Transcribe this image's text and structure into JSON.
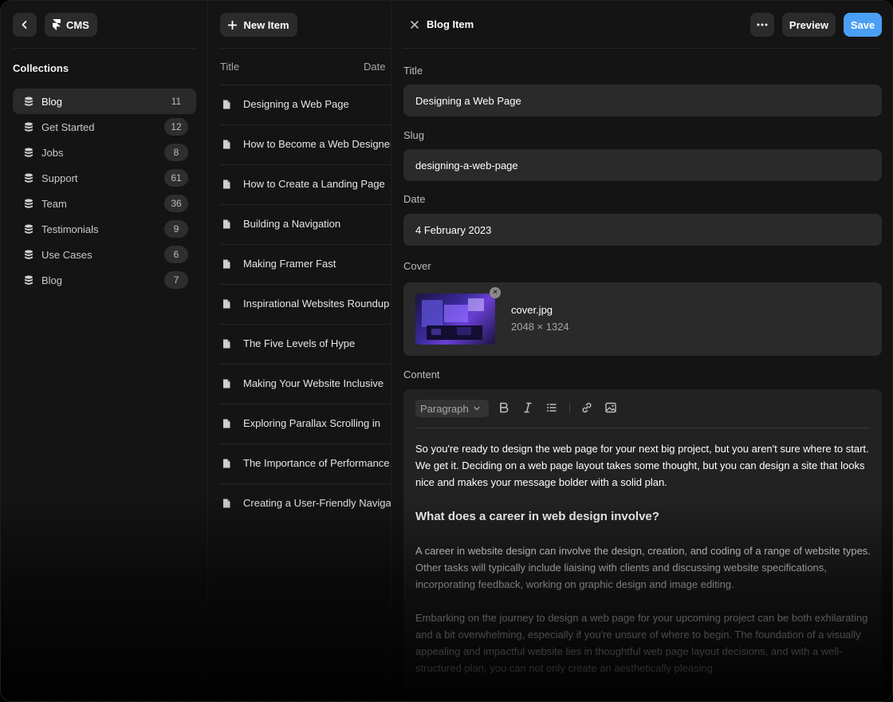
{
  "sidebar": {
    "app_label": "CMS",
    "collections_title": "Collections",
    "items": [
      {
        "label": "Blog",
        "count": "11"
      },
      {
        "label": "Get Started",
        "count": "12"
      },
      {
        "label": "Jobs",
        "count": "8"
      },
      {
        "label": "Support",
        "count": "61"
      },
      {
        "label": "Team",
        "count": "36"
      },
      {
        "label": "Testimonials",
        "count": "9"
      },
      {
        "label": "Use Cases",
        "count": "6"
      },
      {
        "label": "Blog",
        "count": "7"
      }
    ]
  },
  "list": {
    "new_item_label": "New Item",
    "columns": {
      "title": "Title",
      "date": "Date"
    },
    "rows": [
      "Designing a Web Page",
      "How to Become a Web Designer",
      "How to Create a Landing Page",
      "Building a Navigation",
      "Making Framer Fast",
      "Inspirational Websites Roundup",
      "The Five Levels of Hype",
      "Making Your Website Inclusive",
      "Exploring Parallax Scrolling in",
      "The Importance of Performance",
      "Creating a User-Friendly Navigation"
    ]
  },
  "editor": {
    "header_title": "Blog Item",
    "preview_label": "Preview",
    "save_label": "Save",
    "fields": {
      "title_label": "Title",
      "title_value": "Designing a Web Page",
      "slug_label": "Slug",
      "slug_value": "designing-a-web-page",
      "date_label": "Date",
      "date_value": "4 February 2023",
      "cover_label": "Cover",
      "cover_name": "cover.jpg",
      "cover_size": "2048 × 1324",
      "content_label": "Content"
    },
    "toolbar": {
      "block_type": "Paragraph"
    },
    "content": {
      "p1": "So you're ready to design the web page for your next big project, but you aren't sure where to start. We get it. Deciding on a web page layout takes some thought, but you can design a site that looks nice and makes your message bolder with a solid plan.",
      "h2": "What does a career in web design involve?",
      "p2": "A career in website design can involve the design, creation, and coding of a range of website types. Other tasks will typically include liaising with clients and discussing website specifications, incorporating feedback, working on graphic design and image editing.",
      "p3": "Embarking on the journey to design a web page for your upcoming project can be both exhilarating and a bit overwhelming, especially if you're unsure of where to begin. The foundation of a visually appealing and impactful website lies in thoughtful web page layout decisions, and with a well-structured plan, you can not only create an aesthetically pleasing"
    }
  },
  "colors": {
    "accent": "#4a9ff5",
    "panel": "#141414",
    "field": "#2a2a2a"
  }
}
